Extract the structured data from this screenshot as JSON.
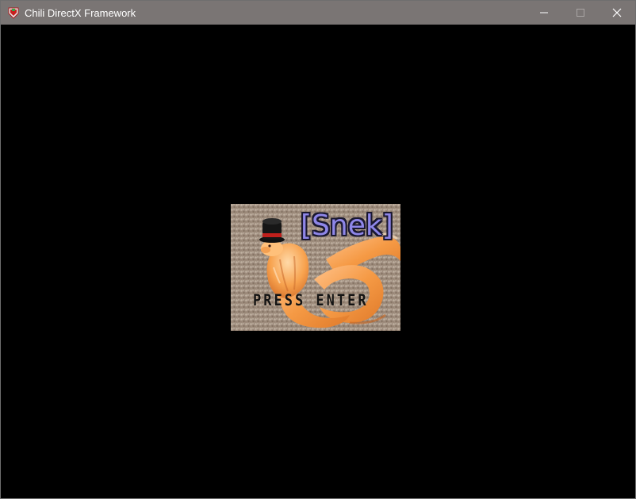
{
  "window": {
    "title": "Chili DirectX Framework",
    "icon": "chili-app-icon",
    "caption_buttons": [
      {
        "name": "minimize",
        "icon": "minimize-icon"
      },
      {
        "name": "maximize",
        "icon": "maximize-icon",
        "disabled": true
      },
      {
        "name": "close",
        "icon": "close-icon"
      }
    ],
    "titlebar_color": "#7a7574",
    "background_color": "#000000"
  },
  "game": {
    "title_screen": {
      "logo": "[Snek]",
      "prompt": "PRESS ENTER",
      "logo_color": "#8e86e8",
      "image": "orange snake wearing a black top hat on a carpet"
    }
  }
}
